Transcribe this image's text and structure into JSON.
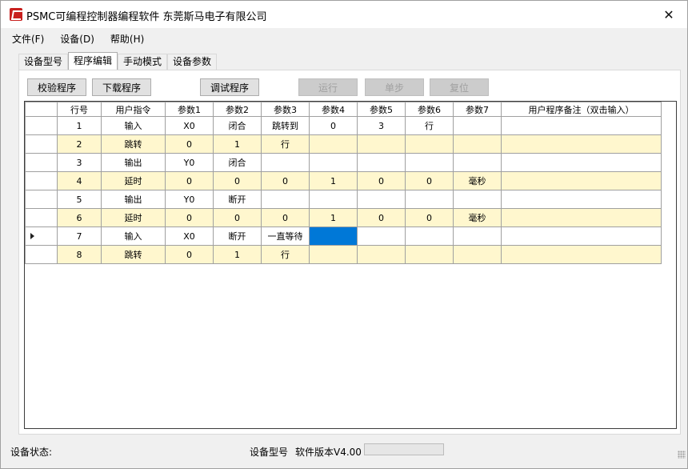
{
  "window": {
    "title": "PSMC可编程控制器编程软件 东莞斯马电子有限公司",
    "close_glyph": "✕"
  },
  "menu": [
    "文件(F)",
    "设备(D)",
    "帮助(H)"
  ],
  "tabs": [
    {
      "label": "设备型号",
      "active": false
    },
    {
      "label": "程序编辑",
      "active": true
    },
    {
      "label": "手动模式",
      "active": false
    },
    {
      "label": "设备参数",
      "active": false
    }
  ],
  "toolbar": {
    "verify": "校验程序",
    "download": "下载程序",
    "debug": "调试程序",
    "run": "运行",
    "step": "单步",
    "reset": "复位"
  },
  "grid": {
    "headers": [
      "行号",
      "用户指令",
      "参数1",
      "参数2",
      "参数3",
      "参数4",
      "参数5",
      "参数6",
      "参数7",
      "用户程序备注（双击输入）"
    ],
    "rows": [
      [
        "1",
        "输入",
        "X0",
        "闭合",
        "跳转到",
        "0",
        "3",
        "行",
        "",
        ""
      ],
      [
        "2",
        "跳转",
        "0",
        "1",
        "行",
        "",
        "",
        "",
        "",
        ""
      ],
      [
        "3",
        "输出",
        "Y0",
        "闭合",
        "",
        "",
        "",
        "",
        "",
        ""
      ],
      [
        "4",
        "延时",
        "0",
        "0",
        "0",
        "1",
        "0",
        "0",
        "毫秒",
        ""
      ],
      [
        "5",
        "输出",
        "Y0",
        "断开",
        "",
        "",
        "",
        "",
        "",
        ""
      ],
      [
        "6",
        "延时",
        "0",
        "0",
        "0",
        "1",
        "0",
        "0",
        "毫秒",
        ""
      ],
      [
        "7",
        "输入",
        "X0",
        "断开",
        "一直等待",
        "",
        "",
        "",
        "",
        ""
      ],
      [
        "8",
        "跳转",
        "0",
        "1",
        "行",
        "",
        "",
        "",
        "",
        ""
      ]
    ],
    "current_row": 7,
    "selected_cell": {
      "row": 7,
      "col": 5
    },
    "alt_row_color": "#fff7ce",
    "selection_color": "#0078d7"
  },
  "status": {
    "state_label": "设备状态:",
    "model_label": "设备型号",
    "version_label": "软件版本V4.00",
    "progress": 0
  }
}
